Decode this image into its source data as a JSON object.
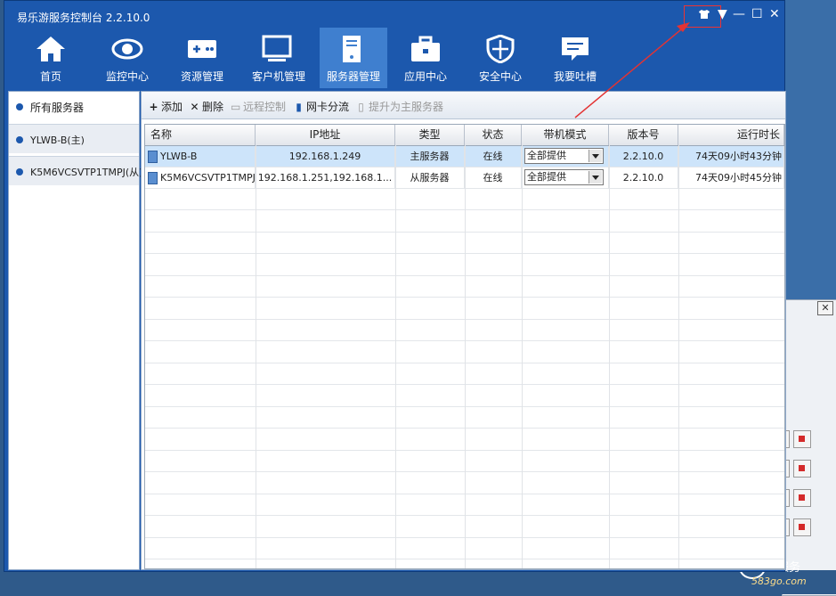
{
  "app": {
    "title": "易乐游服务控制台 2.2.10.0"
  },
  "nav": [
    {
      "label": "首页",
      "icon": "home-icon"
    },
    {
      "label": "监控中心",
      "icon": "eye-icon"
    },
    {
      "label": "资源管理",
      "icon": "gamepad-icon"
    },
    {
      "label": "客户机管理",
      "icon": "monitor-icon"
    },
    {
      "label": "服务器管理",
      "icon": "server-icon"
    },
    {
      "label": "应用中心",
      "icon": "toolbox-icon"
    },
    {
      "label": "安全中心",
      "icon": "shield-icon"
    },
    {
      "label": "我要吐槽",
      "icon": "feedback-icon"
    }
  ],
  "tree": {
    "items": [
      "所有服务器",
      "YLWB-B(主)",
      "K5M6VCSVTP1TMPJ(从)"
    ]
  },
  "toolbar": {
    "add": "添加",
    "delete": "删除",
    "remote": "远程控制",
    "nic_split": "网卡分流",
    "promote": "提升为主服务器"
  },
  "table": {
    "headers": [
      "名称",
      "IP地址",
      "类型",
      "状态",
      "带机模式",
      "版本号",
      "运行时长"
    ],
    "rows": [
      {
        "name": "YLWB-B",
        "ip": "192.168.1.249",
        "type": "主服务器",
        "status": "在线",
        "mode": "全部提供",
        "version": "2.2.10.0",
        "uptime": "74天09小时43分钟"
      },
      {
        "name": "K5M6VCSVTP1TMPJ",
        "ip": "192.168.1.251,192.168.1...",
        "type": "从服务器",
        "status": "在线",
        "mode": "全部提供",
        "version": "2.2.10.0",
        "uptime": "74天09小时45分钟"
      }
    ]
  },
  "watermark": {
    "text": "统服务",
    "url": "583go.com"
  },
  "colors": {
    "titlebar": "#1c58ad",
    "selected_row": "#cde4fa",
    "annotation": "#e33333"
  }
}
